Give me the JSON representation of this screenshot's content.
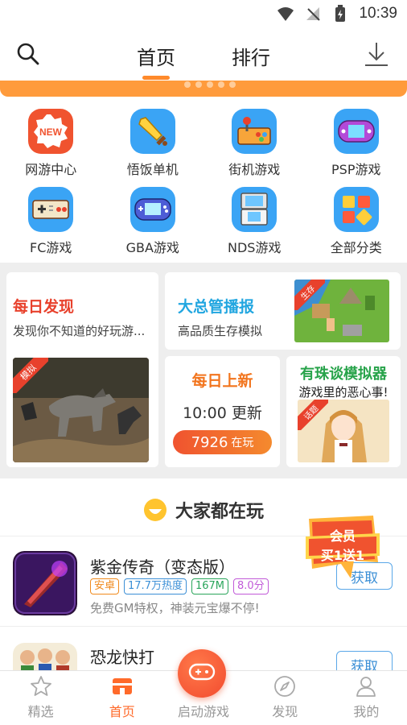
{
  "status_bar": {
    "time": "10:39"
  },
  "header": {
    "tabs": [
      {
        "label": "首页"
      },
      {
        "label": "排行"
      }
    ]
  },
  "categories": [
    {
      "label": "网游中心",
      "icon": "new-badge-icon",
      "color": "#f0532f"
    },
    {
      "label": "悟饭单机",
      "icon": "sword-icon",
      "color": "#3aa4f5"
    },
    {
      "label": "街机游戏",
      "icon": "arcade-joystick-icon",
      "color": "#3aa4f5"
    },
    {
      "label": "PSP游戏",
      "icon": "psp-console-icon",
      "color": "#3aa4f5"
    },
    {
      "label": "FC游戏",
      "icon": "fc-controller-icon",
      "color": "#3aa4f5"
    },
    {
      "label": "GBA游戏",
      "icon": "gba-console-icon",
      "color": "#3aa4f5"
    },
    {
      "label": "NDS游戏",
      "icon": "nds-console-icon",
      "color": "#3aa4f5"
    },
    {
      "label": "全部分类",
      "icon": "all-categories-icon",
      "color": "#3aa4f5"
    }
  ],
  "features": {
    "daily_discover": {
      "title": "每日发现",
      "subtitle": "发现你不知道的好玩游...",
      "badge": "模拟",
      "title_color": "#e8412c"
    },
    "manager": {
      "title": "大总管播报",
      "subtitle": "高品质生存模拟",
      "badge": "生存",
      "title_color": "#21a6e0"
    },
    "daily_new": {
      "title": "每日上新",
      "time_text": "10:00 更新",
      "count": "7926",
      "count_suffix": "在玩",
      "title_color": "#f2751e"
    },
    "pearl": {
      "title": "有珠谈模拟器",
      "subtitle": "游戏里的恶心事!",
      "badge": "话题",
      "title_color": "#27a34a"
    }
  },
  "section": {
    "title": "大家都在玩"
  },
  "games": [
    {
      "name": "紫金传奇（变态版）",
      "tags": [
        {
          "text": "安卓",
          "color": "#f08a1c"
        },
        {
          "text": "17.7万热度",
          "color": "#3b8fd6"
        },
        {
          "text": "167M",
          "color": "#2aa55b"
        },
        {
          "text": "8.0分",
          "color": "#c15ad8"
        }
      ],
      "desc": "免费GM特权，神装元宝爆不停!",
      "button": "获取"
    },
    {
      "name": "恐龙快打",
      "button": "获取"
    }
  ],
  "vip_badge": {
    "line1": "会员",
    "line2": "买1送1"
  },
  "bottom_nav": [
    {
      "label": "精选",
      "icon": "star-icon"
    },
    {
      "label": "首页",
      "icon": "home-icon"
    },
    {
      "label": "启动游戏",
      "icon": "gamepad-icon"
    },
    {
      "label": "发现",
      "icon": "compass-icon"
    },
    {
      "label": "我的",
      "icon": "user-icon"
    }
  ],
  "colors": {
    "accent": "#ff8a2b",
    "active_nav": "#ff6a2a",
    "category_tile": "#3aa4f5"
  }
}
